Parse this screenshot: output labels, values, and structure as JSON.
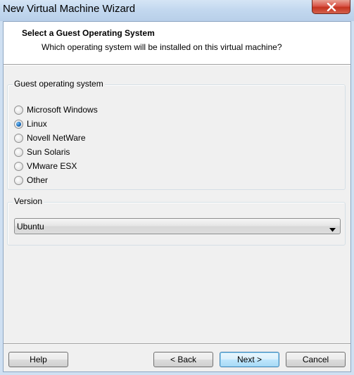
{
  "window": {
    "title": "New Virtual Machine Wizard",
    "close_icon": "close-icon"
  },
  "header": {
    "title": "Select a Guest Operating System",
    "subtitle": "Which operating system will be installed on this virtual machine?"
  },
  "guest_os": {
    "label": "Guest operating system",
    "options": [
      {
        "label": "Microsoft Windows",
        "selected": false
      },
      {
        "label": "Linux",
        "selected": true
      },
      {
        "label": "Novell NetWare",
        "selected": false
      },
      {
        "label": "Sun Solaris",
        "selected": false
      },
      {
        "label": "VMware ESX",
        "selected": false
      },
      {
        "label": "Other",
        "selected": false
      }
    ]
  },
  "version": {
    "label": "Version",
    "selected": "Ubuntu",
    "dropdown_icon": "chevron-down-icon"
  },
  "buttons": {
    "help": "Help",
    "back": "< Back",
    "next": "Next >",
    "cancel": "Cancel"
  }
}
